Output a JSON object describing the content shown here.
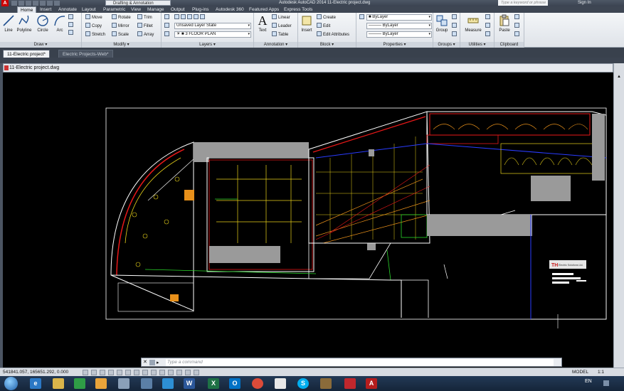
{
  "titlebar": {
    "workspace": "Drafting & Annotation",
    "title": "Autodesk AutoCAD 2014   11-Electric project.dwg",
    "search_placeholder": "Type a keyword or phrase",
    "signin": "Sign In"
  },
  "ribbon_tabs": [
    "Home",
    "Insert",
    "Annotate",
    "Layout",
    "Parametric",
    "View",
    "Manage",
    "Output",
    "Plug-ins",
    "Autodesk 360",
    "Featured Apps",
    "Express Tools"
  ],
  "draw": {
    "title": "Draw",
    "line": "Line",
    "polyline": "Polyline",
    "circle": "Circle",
    "arc": "Arc"
  },
  "modify": {
    "title": "Modify",
    "move": "Move",
    "rotate": "Rotate",
    "trim": "Trim",
    "copy": "Copy",
    "mirror": "Mirror",
    "fillet": "Fillet",
    "stretch": "Stretch",
    "scale": "Scale",
    "array": "Array"
  },
  "layers": {
    "title": "Layers",
    "layer_state": "Unsaved Layer State",
    "current_layer": "3 FLOOR PLAN"
  },
  "annotation": {
    "title": "Annotation",
    "text": "Text",
    "linear": "Linear",
    "leader": "Leader",
    "table": "Table"
  },
  "block": {
    "title": "Block",
    "insert": "Insert",
    "create": "Create",
    "edit": "Edit",
    "edit_attributes": "Edit Attributes"
  },
  "properties": {
    "title": "Properties",
    "color": "ByLayer",
    "linetype": "ByLayer",
    "lineweight": "ByLayer"
  },
  "groups": {
    "title": "Groups",
    "group": "Group"
  },
  "utilities": {
    "title": "Utilities",
    "measure": "Measure"
  },
  "clipboard": {
    "title": "Clipboard",
    "paste": "Paste"
  },
  "doc_tabs": [
    "11-Electric project*",
    "Electric Projects-Web*"
  ],
  "drawing_title": "11-Electric project.dwg",
  "titleblock_logo_text": "Electric Solutions Ltd.",
  "command": {
    "placeholder": "Type a command"
  },
  "status": {
    "coords": "541841.057, 165651.292, 0.000",
    "model": "MODEL",
    "scale": "1:1"
  },
  "taskbar": {
    "lang": "EN"
  },
  "colors": {
    "bg": "#000000",
    "wall": "#ffffff",
    "red": "#e81818",
    "yellow": "#e8d21a",
    "orange": "#e8901a",
    "green": "#2ad62a",
    "blue": "#2a3cff",
    "gray": "#9a9a9a"
  }
}
